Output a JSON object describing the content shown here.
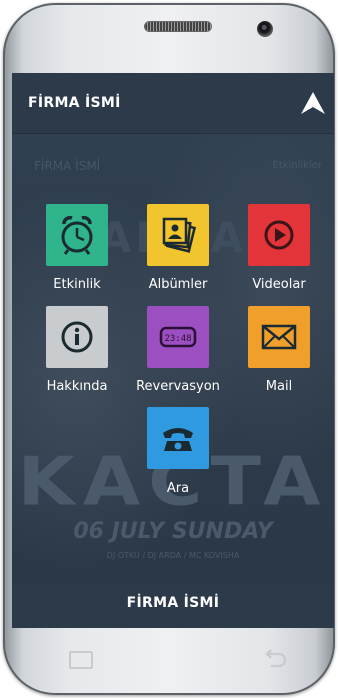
{
  "header": {
    "title": "FİRMA İSMİ"
  },
  "subbar": {
    "title": "FİRMA İSMİ",
    "right": "Etkinlikler"
  },
  "background": {
    "poster_a": "ARDA",
    "poster_headline": "KACTA",
    "poster_date": "06 JULY SUNDAY",
    "poster_djs": "DJ OTKU / DJ ARDA / MC KOVISHA"
  },
  "menu": {
    "items": [
      {
        "label": "Etkinlik",
        "icon": "alarm-clock-icon",
        "color": "#2fb48c"
      },
      {
        "label": "Albümler",
        "icon": "photo-album-icon",
        "color": "#f2c42e"
      },
      {
        "label": "Videolar",
        "icon": "play-icon",
        "color": "#e3343a"
      },
      {
        "label": "Hakkında",
        "icon": "info-icon",
        "color": "#c9ccce"
      },
      {
        "label": "Revervasyon",
        "icon": "digital-clock-icon",
        "color": "#9b4fc0"
      },
      {
        "label": "Mail",
        "icon": "mail-icon",
        "color": "#f0a02a"
      },
      {
        "label": "Ara",
        "icon": "phone-icon",
        "color": "#2f9ae0"
      }
    ],
    "reservation_clock_text": "23:48"
  },
  "footer": {
    "title": "FİRMA İSMİ"
  }
}
